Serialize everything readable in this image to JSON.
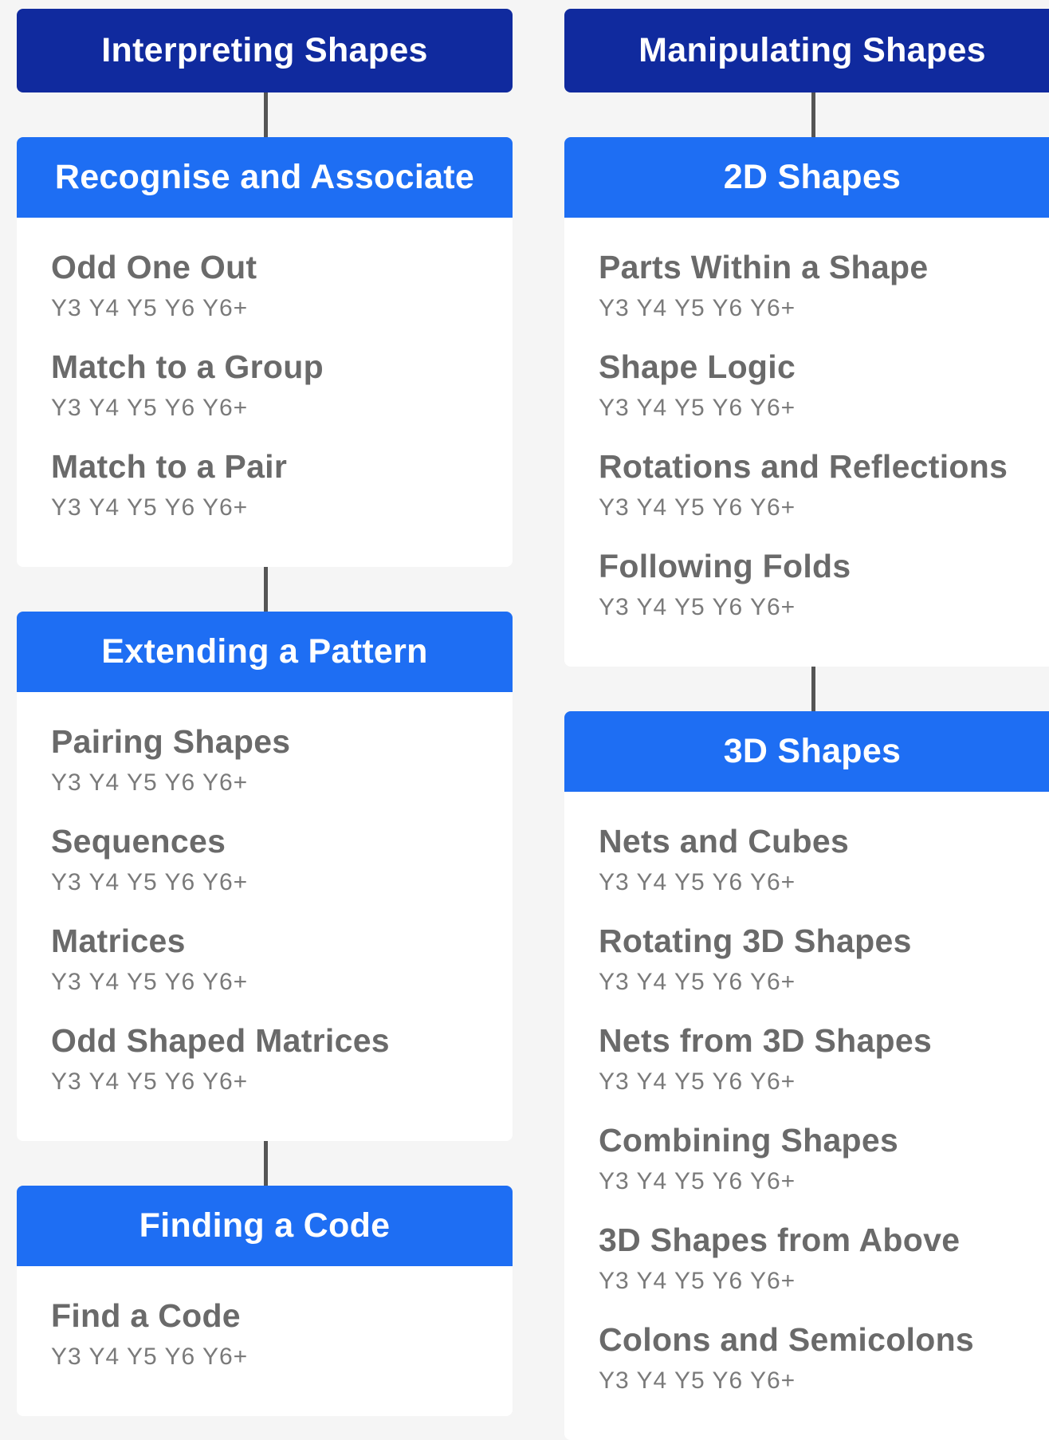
{
  "columns": [
    {
      "title": "Interpreting Shapes",
      "sections": [
        {
          "title": "Recognise and Associate",
          "topics": [
            {
              "name": "Odd One Out",
              "years": "Y3 Y4 Y5 Y6 Y6+"
            },
            {
              "name": "Match to a Group",
              "years": "Y3 Y4 Y5 Y6 Y6+"
            },
            {
              "name": "Match to a Pair",
              "years": "Y3 Y4 Y5 Y6 Y6+"
            }
          ]
        },
        {
          "title": "Extending a Pattern",
          "topics": [
            {
              "name": "Pairing Shapes",
              "years": "Y3 Y4 Y5 Y6 Y6+"
            },
            {
              "name": "Sequences",
              "years": "Y3 Y4 Y5 Y6 Y6+"
            },
            {
              "name": "Matrices",
              "years": "Y3 Y4 Y5 Y6 Y6+"
            },
            {
              "name": "Odd Shaped Matrices",
              "years": "Y3 Y4 Y5 Y6 Y6+"
            }
          ]
        },
        {
          "title": "Finding a Code",
          "topics": [
            {
              "name": "Find a Code",
              "years": "Y3 Y4 Y5 Y6 Y6+"
            }
          ]
        }
      ]
    },
    {
      "title": "Manipulating Shapes",
      "sections": [
        {
          "title": "2D Shapes",
          "topics": [
            {
              "name": "Parts Within a Shape",
              "years": "Y3 Y4 Y5 Y6 Y6+"
            },
            {
              "name": "Shape Logic",
              "years": "Y3 Y4 Y5 Y6 Y6+"
            },
            {
              "name": "Rotations and Reflections",
              "years": "Y3 Y4 Y5 Y6 Y6+"
            },
            {
              "name": "Following Folds",
              "years": "Y3 Y4 Y5 Y6 Y6+"
            }
          ]
        },
        {
          "title": "3D Shapes",
          "topics": [
            {
              "name": "Nets and Cubes",
              "years": "Y3 Y4 Y5 Y6 Y6+"
            },
            {
              "name": "Rotating 3D Shapes",
              "years": "Y3 Y4 Y5 Y6 Y6+"
            },
            {
              "name": "Nets from 3D Shapes",
              "years": "Y3 Y4 Y5 Y6 Y6+"
            },
            {
              "name": "Combining Shapes",
              "years": "Y3 Y4 Y5 Y6 Y6+"
            },
            {
              "name": "3D Shapes from Above",
              "years": "Y3 Y4 Y5 Y6 Y6+"
            },
            {
              "name": "Colons and Semicolons",
              "years": "Y3 Y4 Y5 Y6 Y6+"
            }
          ]
        }
      ]
    }
  ],
  "colors": {
    "top_header": "#102a9e",
    "section_header": "#1e6ef3",
    "connector": "#555555",
    "topic_text": "#6a6a6a",
    "background": "#f5f5f5"
  }
}
